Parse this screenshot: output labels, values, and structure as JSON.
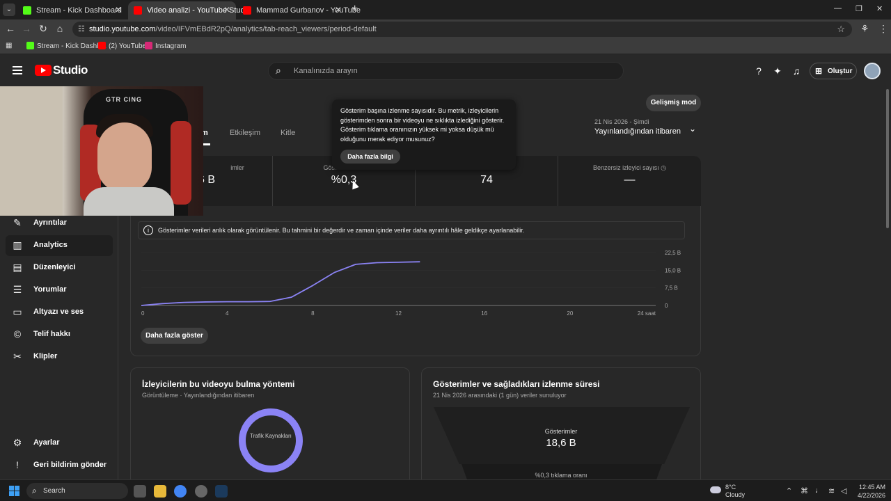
{
  "browser": {
    "tabs": [
      {
        "title": "Stream - Kick Dashboard",
        "favicon_color": "#53fc18",
        "active": false
      },
      {
        "title": "Video analizi - YouTube Studio",
        "favicon_color": "#ff0000",
        "active": true
      },
      {
        "title": "Mammad Gurbanov - YouTube",
        "favicon_color": "#ff0000",
        "active": false
      }
    ],
    "url_host": "studio.youtube.com",
    "url_path": "/video/IFVmEBdR2pQ/analytics/tab-reach_viewers/period-default",
    "bookmarks": [
      {
        "label": "Stream - Kick Dashb...",
        "color": "#53fc18"
      },
      {
        "label": "(2) YouTube",
        "color": "#ff0000"
      },
      {
        "label": "Instagram",
        "color": "#d62976"
      }
    ]
  },
  "studio": {
    "logo_text": "Studio",
    "search_placeholder": "Kanalınızda arayın",
    "create_label": "Oluştur",
    "advanced_mode": "Gelişmiş mod",
    "tabs": [
      {
        "label": "m",
        "active": true
      },
      {
        "label": "Etkileşim",
        "active": false
      },
      {
        "label": "Kitle",
        "active": false
      }
    ],
    "date_small": "21 Nis 2026 - Şimdi",
    "date_range": "Yayınlandığından itibaren"
  },
  "sidebar": {
    "items": [
      {
        "label": "Ayrıntılar",
        "icon": "pencil-icon",
        "glyph": "✎",
        "active": false
      },
      {
        "label": "Analytics",
        "icon": "analytics-icon",
        "glyph": "▥",
        "active": true
      },
      {
        "label": "Düzenleyici",
        "icon": "editor-icon",
        "glyph": "▤",
        "active": false
      },
      {
        "label": "Yorumlar",
        "icon": "comments-icon",
        "glyph": "☰",
        "active": false
      },
      {
        "label": "Altyazı ve ses",
        "icon": "subtitles-icon",
        "glyph": "▭",
        "active": false
      },
      {
        "label": "Telif hakkı",
        "icon": "copyright-icon",
        "glyph": "©",
        "active": false
      },
      {
        "label": "Klipler",
        "icon": "scissors-icon",
        "glyph": "✂",
        "active": false
      }
    ],
    "bottom": [
      {
        "label": "Ayarlar",
        "icon": "gear-icon",
        "glyph": "⚙"
      },
      {
        "label": "Geri bildirim gönder",
        "icon": "feedback-icon",
        "glyph": "!"
      }
    ]
  },
  "webcam": {
    "brand": "GTR CING"
  },
  "metrics": [
    {
      "label": "imler",
      "value": "6 B"
    },
    {
      "label": "Gösteri",
      "value": "%0,3"
    },
    {
      "label": "",
      "value": "74"
    },
    {
      "label": "Benzersiz izleyici sayısı",
      "value": "—"
    }
  ],
  "tooltip": {
    "text": "Gösterim başına izlenme sayısıdır. Bu metrik, izleyicilerin gösterimden sonra bir videoyu ne sıklıkta izlediğini gösterir. Gösterim tıklama oranınızın yüksek mi yoksa düşük mü olduğunu merak ediyor musunuz?",
    "button": "Daha fazla bilgi"
  },
  "info_text": "Gösterimler verileri anlık olarak görüntülenir. Bu tahmini bir değerdir ve zaman içinde veriler daha ayrıntılı hâle geldikçe ayarlanabilir.",
  "more_button": "Daha fazla göster",
  "chart_data": {
    "type": "line",
    "x": [
      0,
      1,
      2,
      3,
      4,
      5,
      6,
      7,
      8,
      9,
      10,
      11,
      12,
      13
    ],
    "values": [
      0,
      0.8,
      1.3,
      1.5,
      1.6,
      1.6,
      1.7,
      3.5,
      8.5,
      14,
      17.5,
      18.2,
      18.4,
      18.6
    ],
    "x_ticks": [
      "0",
      "4",
      "8",
      "12",
      "16",
      "20",
      "24 saat"
    ],
    "x_tick_values": [
      0,
      4,
      8,
      12,
      16,
      20,
      24
    ],
    "y_ticks": [
      "0",
      "7,5 B",
      "15,0 B",
      "22,5 B"
    ],
    "y_tick_values": [
      0,
      7.5,
      15,
      22.5
    ],
    "xlim": [
      0,
      24
    ],
    "ylim": [
      0,
      22.5
    ],
    "color": "#8b83f5"
  },
  "card_find": {
    "title": "İzleyicilerin bu videoyu bulma yöntemi",
    "subtitle": "Görüntüleme · Yayınlandığından itibaren",
    "donut_label": "Trafik Kaynakları"
  },
  "card_funnel": {
    "title": "Gösterimler ve sağladıkları izlenme süresi",
    "subtitle": "21 Nis 2026 arasındaki (1 gün) veriler sunuluyor",
    "impressions_label": "Gösterimler",
    "impressions_value": "18,6 B",
    "ctr_label": "%0,3 tıklama oranı"
  },
  "taskbar": {
    "search": "Search",
    "weather_temp": "8°C",
    "weather_desc": "Cloudy",
    "time": "12:45 AM",
    "date": "4/22/2026"
  }
}
